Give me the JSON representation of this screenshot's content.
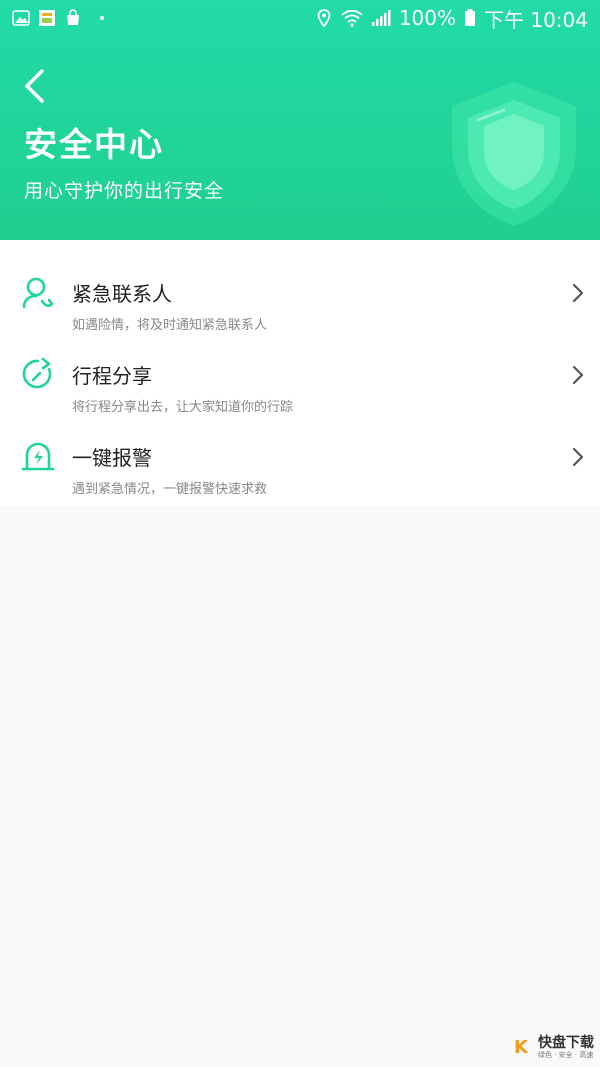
{
  "status_bar": {
    "battery": "100%",
    "time": "下午 10:04"
  },
  "header": {
    "title": "安全中心",
    "subtitle": "用心守护你的出行安全"
  },
  "menu": {
    "items": [
      {
        "title": "紧急联系人",
        "desc": "如遇险情，将及时通知紧急联系人",
        "icon": "contact-icon"
      },
      {
        "title": "行程分享",
        "desc": "将行程分享出去，让大家知道你的行踪",
        "icon": "share-trip-icon"
      },
      {
        "title": "一键报警",
        "desc": "遇到紧急情况，一键报警快速求救",
        "icon": "alarm-icon"
      }
    ]
  },
  "watermark": {
    "logo_char": "K",
    "main": "快盘下载",
    "sub": "绿色 · 安全 · 高速"
  },
  "colors": {
    "accent": "#21d49c",
    "header_top": "#22dba8",
    "header_bottom": "#1fcf8f"
  }
}
